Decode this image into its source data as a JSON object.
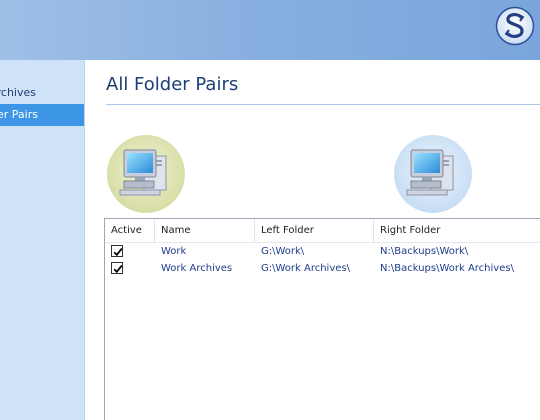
{
  "sidebar": {
    "items": [
      {
        "label": "Work Archives",
        "selected": false
      },
      {
        "label": "All Folder Pairs",
        "selected": true
      }
    ]
  },
  "main": {
    "title": "All Folder Pairs",
    "left_icon": "computer-icon",
    "right_icon": "computer-icon"
  },
  "table": {
    "columns": [
      "Active",
      "Name",
      "Left Folder",
      "Right Folder"
    ],
    "rows": [
      {
        "active": true,
        "name": "Work",
        "left": "G:\\Work\\",
        "right": "N:\\Backups\\Work\\"
      },
      {
        "active": true,
        "name": "Work Archives",
        "left": "G:\\Work Archives\\",
        "right": "N:\\Backups\\Work Archives\\"
      }
    ]
  },
  "colors": {
    "accent": "#3d95e6",
    "title": "#1b3f76",
    "sidebar": "#cfe3f8",
    "link_text": "#1e3d8a"
  }
}
